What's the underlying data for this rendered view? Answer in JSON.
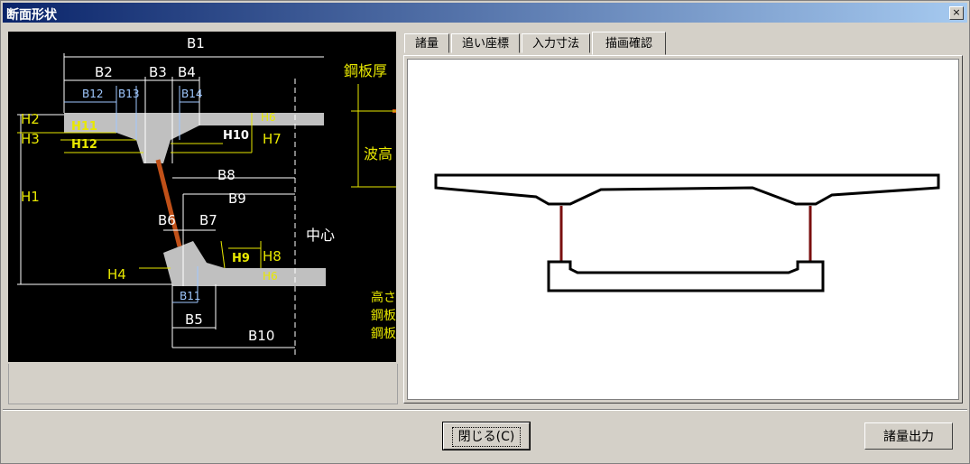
{
  "window": {
    "title": "断面形状",
    "close_icon": "×"
  },
  "diagram": {
    "labels": {
      "B1": "B1",
      "B2": "B2",
      "B3": "B3",
      "B4": "B4",
      "B12": "B12",
      "B13": "B13",
      "B14": "B14",
      "H2": "H2",
      "H3": "H3",
      "H11": "H11",
      "H12": "H12",
      "H10": "H10",
      "H7": "H7",
      "H6a": "H6",
      "H6b": "H6",
      "B8": "B8",
      "B9": "B9",
      "H1": "H1",
      "B6": "B6",
      "B7": "B7",
      "H9": "H9",
      "H8": "H8",
      "H4": "H4",
      "B11": "B11",
      "B5": "B5",
      "B10": "B10",
      "steel_thickness": "鋼板厚",
      "wave_height": "波高",
      "center": "中心",
      "height_cut": "高さ",
      "steel_1": "鋼板",
      "steel_2": "鋼板"
    },
    "colors": {
      "concrete": "#c0c0c0",
      "steel_web": "#c05018",
      "dim_white": "#ffffff",
      "dim_yellow": "#e8e800",
      "dim_blue": "#9fc8ff"
    }
  },
  "tabs": [
    {
      "label": "諸量",
      "active": false
    },
    {
      "label": "追い座標",
      "active": false
    },
    {
      "label": "入力寸法",
      "active": false
    },
    {
      "label": "描画確認",
      "active": true
    }
  ],
  "buttons": {
    "close": "閉じる(C)",
    "output": "諸量出力"
  }
}
